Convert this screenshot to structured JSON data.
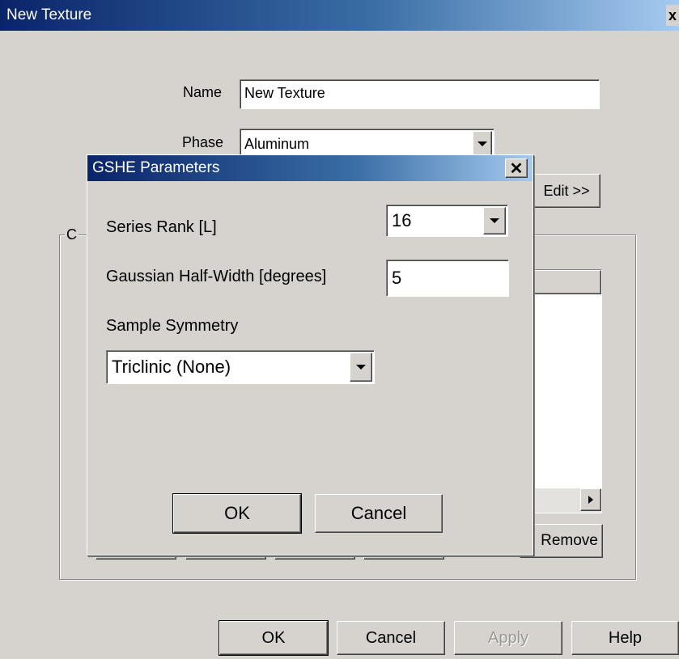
{
  "main_window": {
    "title": "New Texture",
    "close_glyph": "x",
    "name_label": "Name",
    "name_value": "New Texture",
    "phase_label": "Phase",
    "phase_value": "Aluminum",
    "edit_button": "Edit >>",
    "group_label": "C",
    "remove_button": "Remove",
    "ok_button": "OK",
    "cancel_button": "Cancel",
    "apply_button": "Apply",
    "help_button": "Help"
  },
  "dialog": {
    "title": "GSHE Parameters",
    "close_glyph": "✕",
    "series_rank_label": "Series Rank [L]",
    "series_rank_value": "16",
    "gaussian_label": "Gaussian Half-Width [degrees]",
    "gaussian_value": "5",
    "sample_symmetry_label": "Sample Symmetry",
    "sample_symmetry_value": "Triclinic (None)",
    "ok_button": "OK",
    "cancel_button": "Cancel"
  },
  "icons": {
    "dropdown": "chevron-down-icon",
    "scroll_right": "arrow-right-icon"
  }
}
